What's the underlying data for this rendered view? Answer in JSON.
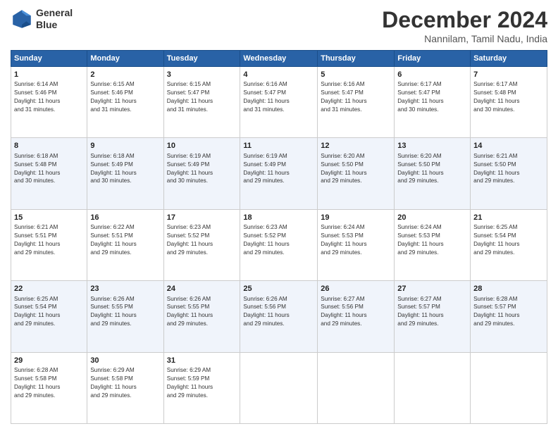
{
  "logo": {
    "line1": "General",
    "line2": "Blue"
  },
  "header": {
    "month": "December 2024",
    "location": "Nannilam, Tamil Nadu, India"
  },
  "weekdays": [
    "Sunday",
    "Monday",
    "Tuesday",
    "Wednesday",
    "Thursday",
    "Friday",
    "Saturday"
  ],
  "weeks": [
    [
      {
        "day": "1",
        "info": "Sunrise: 6:14 AM\nSunset: 5:46 PM\nDaylight: 11 hours\nand 31 minutes."
      },
      {
        "day": "2",
        "info": "Sunrise: 6:15 AM\nSunset: 5:46 PM\nDaylight: 11 hours\nand 31 minutes."
      },
      {
        "day": "3",
        "info": "Sunrise: 6:15 AM\nSunset: 5:47 PM\nDaylight: 11 hours\nand 31 minutes."
      },
      {
        "day": "4",
        "info": "Sunrise: 6:16 AM\nSunset: 5:47 PM\nDaylight: 11 hours\nand 31 minutes."
      },
      {
        "day": "5",
        "info": "Sunrise: 6:16 AM\nSunset: 5:47 PM\nDaylight: 11 hours\nand 31 minutes."
      },
      {
        "day": "6",
        "info": "Sunrise: 6:17 AM\nSunset: 5:47 PM\nDaylight: 11 hours\nand 30 minutes."
      },
      {
        "day": "7",
        "info": "Sunrise: 6:17 AM\nSunset: 5:48 PM\nDaylight: 11 hours\nand 30 minutes."
      }
    ],
    [
      {
        "day": "8",
        "info": "Sunrise: 6:18 AM\nSunset: 5:48 PM\nDaylight: 11 hours\nand 30 minutes."
      },
      {
        "day": "9",
        "info": "Sunrise: 6:18 AM\nSunset: 5:49 PM\nDaylight: 11 hours\nand 30 minutes."
      },
      {
        "day": "10",
        "info": "Sunrise: 6:19 AM\nSunset: 5:49 PM\nDaylight: 11 hours\nand 30 minutes."
      },
      {
        "day": "11",
        "info": "Sunrise: 6:19 AM\nSunset: 5:49 PM\nDaylight: 11 hours\nand 29 minutes."
      },
      {
        "day": "12",
        "info": "Sunrise: 6:20 AM\nSunset: 5:50 PM\nDaylight: 11 hours\nand 29 minutes."
      },
      {
        "day": "13",
        "info": "Sunrise: 6:20 AM\nSunset: 5:50 PM\nDaylight: 11 hours\nand 29 minutes."
      },
      {
        "day": "14",
        "info": "Sunrise: 6:21 AM\nSunset: 5:50 PM\nDaylight: 11 hours\nand 29 minutes."
      }
    ],
    [
      {
        "day": "15",
        "info": "Sunrise: 6:21 AM\nSunset: 5:51 PM\nDaylight: 11 hours\nand 29 minutes."
      },
      {
        "day": "16",
        "info": "Sunrise: 6:22 AM\nSunset: 5:51 PM\nDaylight: 11 hours\nand 29 minutes."
      },
      {
        "day": "17",
        "info": "Sunrise: 6:23 AM\nSunset: 5:52 PM\nDaylight: 11 hours\nand 29 minutes."
      },
      {
        "day": "18",
        "info": "Sunrise: 6:23 AM\nSunset: 5:52 PM\nDaylight: 11 hours\nand 29 minutes."
      },
      {
        "day": "19",
        "info": "Sunrise: 6:24 AM\nSunset: 5:53 PM\nDaylight: 11 hours\nand 29 minutes."
      },
      {
        "day": "20",
        "info": "Sunrise: 6:24 AM\nSunset: 5:53 PM\nDaylight: 11 hours\nand 29 minutes."
      },
      {
        "day": "21",
        "info": "Sunrise: 6:25 AM\nSunset: 5:54 PM\nDaylight: 11 hours\nand 29 minutes."
      }
    ],
    [
      {
        "day": "22",
        "info": "Sunrise: 6:25 AM\nSunset: 5:54 PM\nDaylight: 11 hours\nand 29 minutes."
      },
      {
        "day": "23",
        "info": "Sunrise: 6:26 AM\nSunset: 5:55 PM\nDaylight: 11 hours\nand 29 minutes."
      },
      {
        "day": "24",
        "info": "Sunrise: 6:26 AM\nSunset: 5:55 PM\nDaylight: 11 hours\nand 29 minutes."
      },
      {
        "day": "25",
        "info": "Sunrise: 6:26 AM\nSunset: 5:56 PM\nDaylight: 11 hours\nand 29 minutes."
      },
      {
        "day": "26",
        "info": "Sunrise: 6:27 AM\nSunset: 5:56 PM\nDaylight: 11 hours\nand 29 minutes."
      },
      {
        "day": "27",
        "info": "Sunrise: 6:27 AM\nSunset: 5:57 PM\nDaylight: 11 hours\nand 29 minutes."
      },
      {
        "day": "28",
        "info": "Sunrise: 6:28 AM\nSunset: 5:57 PM\nDaylight: 11 hours\nand 29 minutes."
      }
    ],
    [
      {
        "day": "29",
        "info": "Sunrise: 6:28 AM\nSunset: 5:58 PM\nDaylight: 11 hours\nand 29 minutes."
      },
      {
        "day": "30",
        "info": "Sunrise: 6:29 AM\nSunset: 5:58 PM\nDaylight: 11 hours\nand 29 minutes."
      },
      {
        "day": "31",
        "info": "Sunrise: 6:29 AM\nSunset: 5:59 PM\nDaylight: 11 hours\nand 29 minutes."
      },
      {
        "day": "",
        "info": ""
      },
      {
        "day": "",
        "info": ""
      },
      {
        "day": "",
        "info": ""
      },
      {
        "day": "",
        "info": ""
      }
    ]
  ]
}
